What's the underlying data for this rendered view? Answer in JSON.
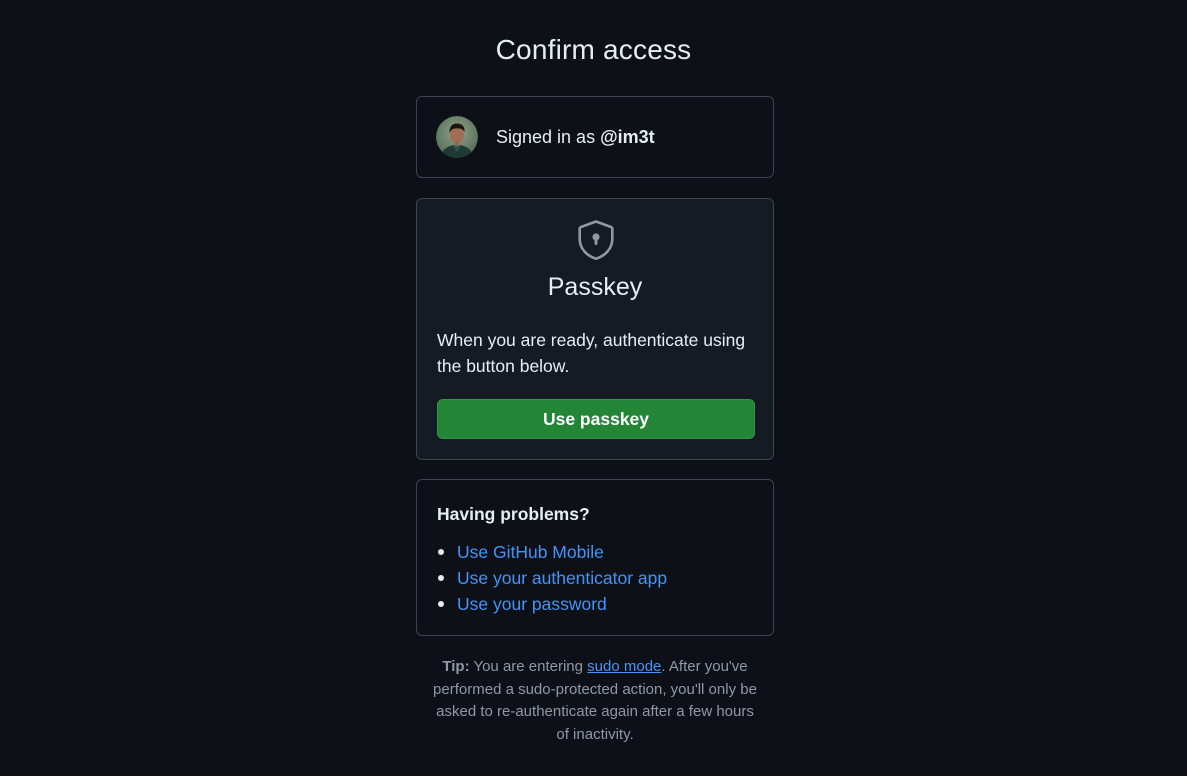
{
  "page": {
    "title": "Confirm access"
  },
  "account": {
    "signed_in_prefix": "Signed in as",
    "username": "@im3t",
    "avatar_icon": "user-avatar"
  },
  "passkey": {
    "icon": "shield-lock-icon",
    "title": "Passkey",
    "description": "When you are ready, authenticate using the button below.",
    "button_label": "Use passkey",
    "button_color": "#238636"
  },
  "problems": {
    "title": "Having problems?",
    "links": [
      {
        "label": "Use GitHub Mobile"
      },
      {
        "label": "Use your authenticator app"
      },
      {
        "label": "Use your password"
      }
    ],
    "link_color": "#4493f8"
  },
  "tip": {
    "label": "Tip:",
    "text_before": " You are entering ",
    "link_label": "sudo mode",
    "text_after": ". After you've performed a sudo-protected action, you'll only be asked to re-authenticate again after a few hours of inactivity."
  },
  "colors": {
    "background": "#0d1117",
    "panel": "#151b23",
    "border": "#3d444d"
  }
}
